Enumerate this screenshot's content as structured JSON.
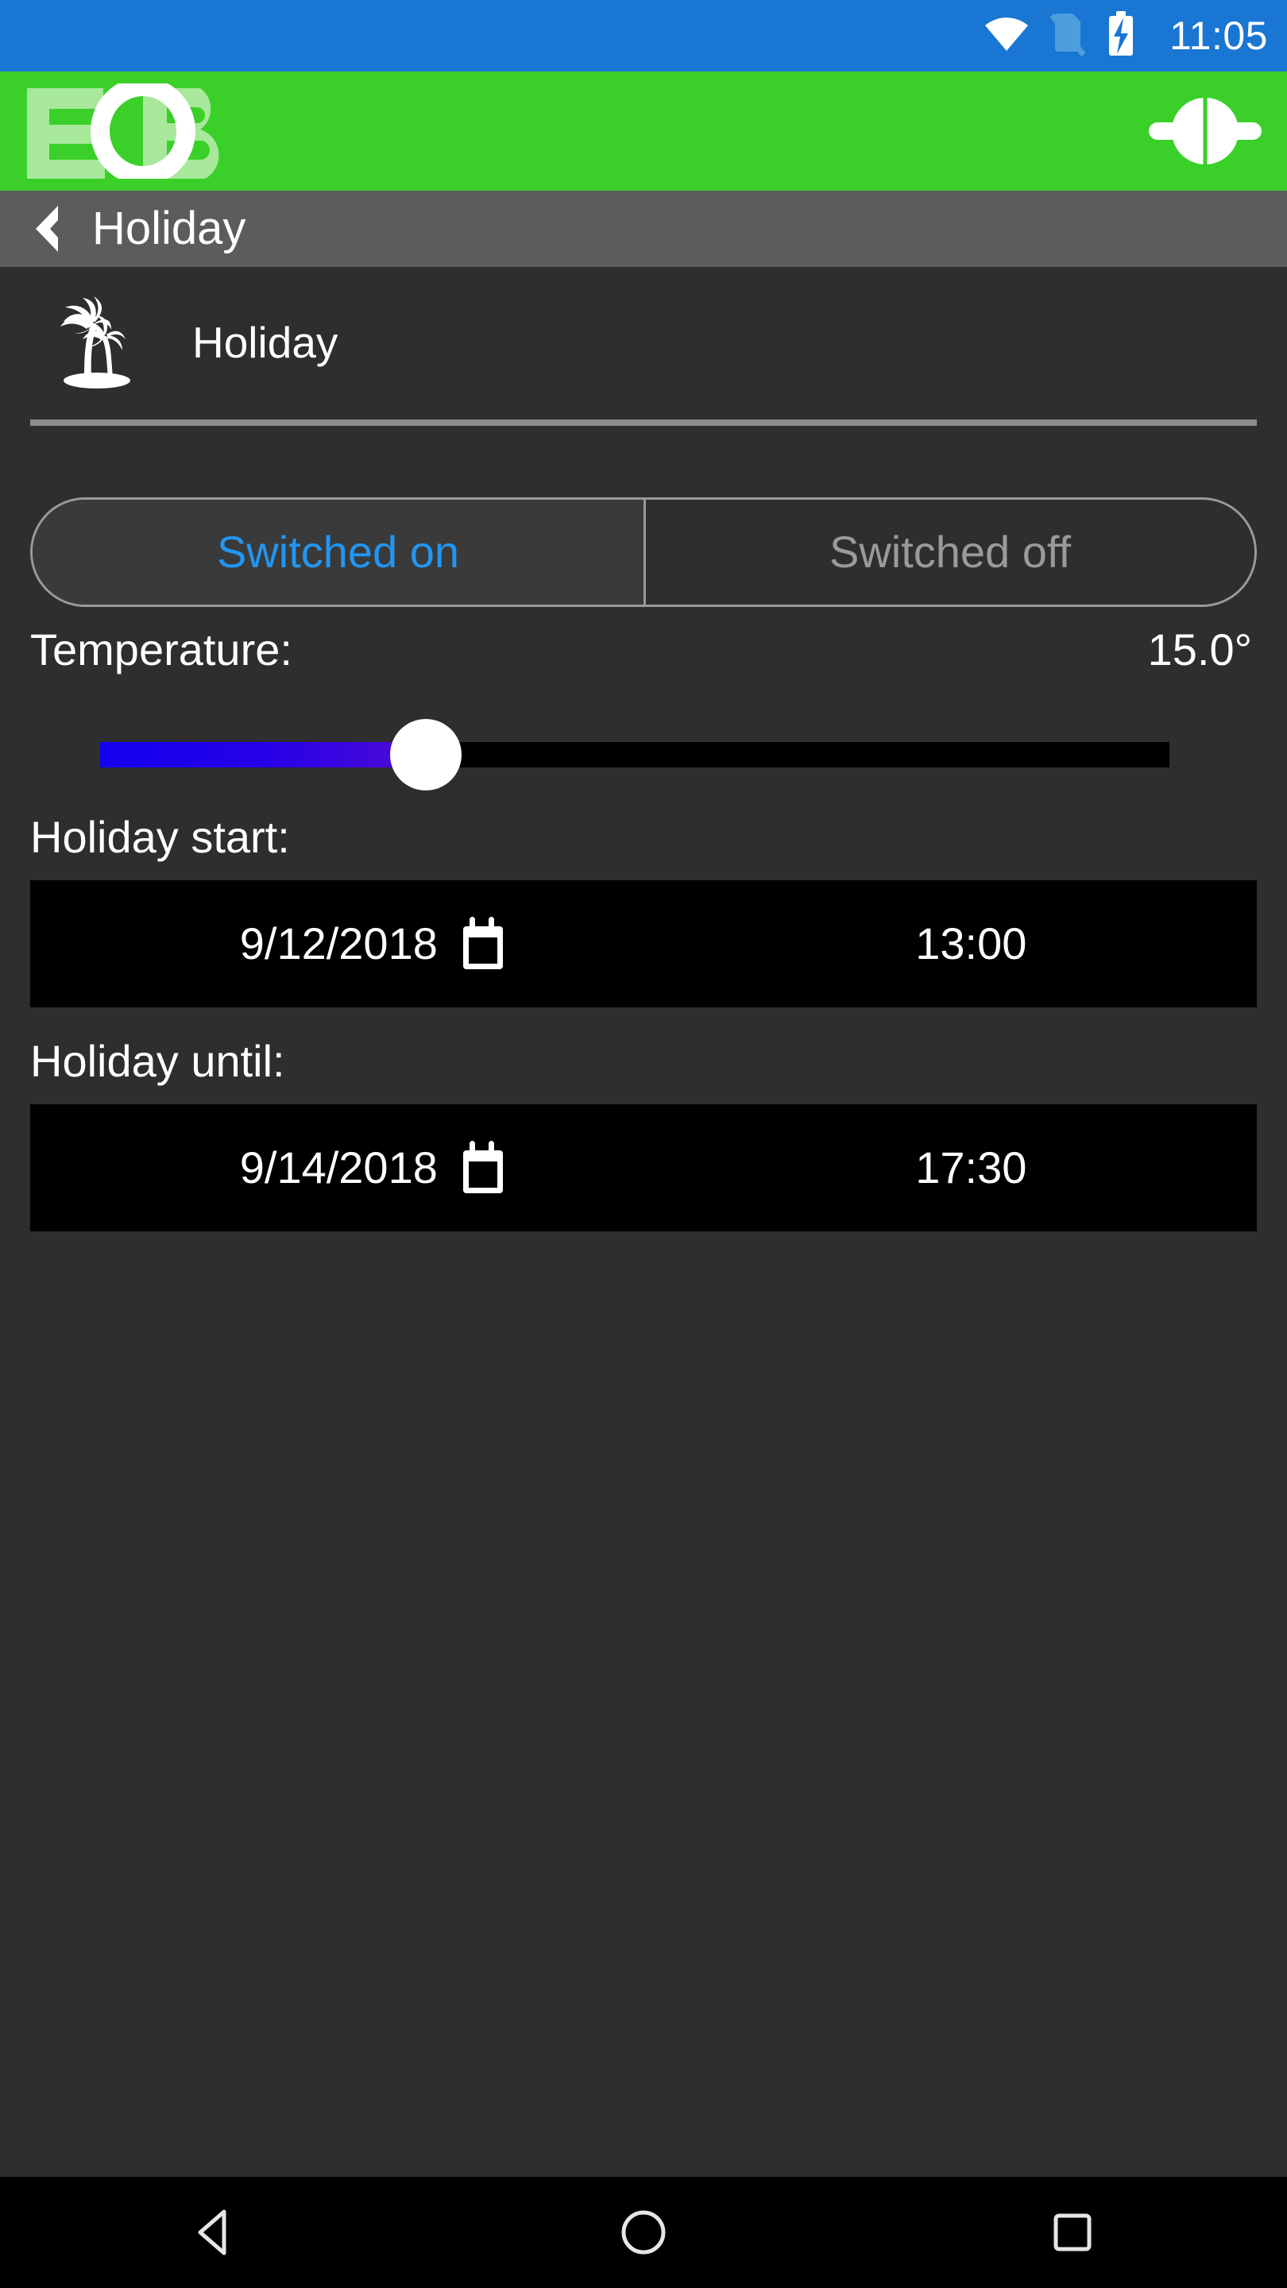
{
  "status_bar": {
    "background_color": "#1976d2",
    "clock": "11:05",
    "icons": [
      "wifi-icon",
      "sim-off-icon",
      "battery-charging-icon"
    ]
  },
  "brand_bar": {
    "background_color": "#3ad029",
    "logo_text": "EOB",
    "action_icon": "target-connector-icon"
  },
  "nav_bar": {
    "back_icon": "back-chevron-icon",
    "title": "Holiday"
  },
  "page": {
    "icon": "palm-tree-icon",
    "title": "Holiday"
  },
  "mode_toggle": {
    "options": [
      {
        "label": "Switched on",
        "selected": true
      },
      {
        "label": "Switched off",
        "selected": false
      }
    ],
    "selected_color": "#2196f3",
    "unselected_color": "#9a9a9a"
  },
  "temperature": {
    "label": "Temperature:",
    "value": "15.0°",
    "slider": {
      "fill_start_color": "#1400f0",
      "fill_end_color": "#4a0ad8",
      "track_color": "#000000",
      "thumb_color": "#ffffff"
    }
  },
  "holiday_start": {
    "label": "Holiday start:",
    "date": "9/12/2018",
    "time": "13:00",
    "calendar_icon": "calendar-icon"
  },
  "holiday_until": {
    "label": "Holiday until:",
    "date": "9/14/2018",
    "time": "17:30",
    "calendar_icon": "calendar-icon"
  },
  "system_nav": {
    "back": "android-back-icon",
    "home": "android-home-icon",
    "recents": "android-recents-icon"
  }
}
